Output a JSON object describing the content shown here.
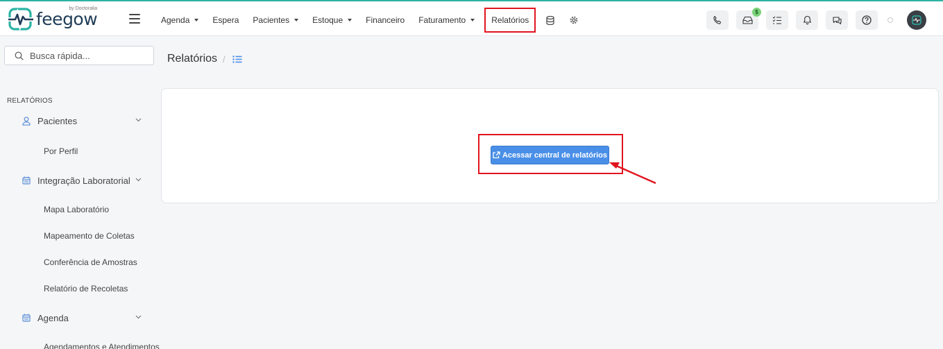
{
  "brand": {
    "name": "feegow",
    "tagline": "by Doctoralia"
  },
  "nav": {
    "items": [
      {
        "label": "Agenda",
        "dropdown": true
      },
      {
        "label": "Espera",
        "dropdown": false
      },
      {
        "label": "Pacientes",
        "dropdown": true
      },
      {
        "label": "Estoque",
        "dropdown": true
      },
      {
        "label": "Financeiro",
        "dropdown": false
      },
      {
        "label": "Faturamento",
        "dropdown": true
      },
      {
        "label": "Relatórios",
        "dropdown": false,
        "highlighted": true
      }
    ],
    "extra_icons": [
      "database-icon",
      "gear-icon"
    ]
  },
  "toolbar_icons": [
    "phone-icon",
    "inbox-icon",
    "checklist-icon",
    "bell-icon",
    "chat-icon",
    "help-icon"
  ],
  "inbox_badge": "$",
  "search": {
    "placeholder": "Busca rápida..."
  },
  "sidebar": {
    "section_title": "RELATÓRIOS",
    "groups": [
      {
        "label": "Pacientes",
        "icon": "user-icon",
        "items": [
          "Por Perfil"
        ]
      },
      {
        "label": "Integração Laboratorial",
        "icon": "calendar-icon",
        "items": [
          "Mapa Laboratório",
          "Mapeamento de Coletas",
          "Conferência de Amostras",
          "Relatório de Recoletas"
        ]
      },
      {
        "label": "Agenda",
        "icon": "calendar-icon",
        "items": [
          "Agendamentos e Atendimentos"
        ]
      }
    ]
  },
  "page": {
    "title": "Relatórios",
    "separator": "/"
  },
  "main_button": {
    "label": "Acessar central de relatórios",
    "icon": "external-link-icon"
  },
  "colors": {
    "accent": "#4a8fe7",
    "highlight": "#e0141e",
    "brand_teal": "#2bb3a3",
    "brand_navy": "#1f3c57"
  }
}
